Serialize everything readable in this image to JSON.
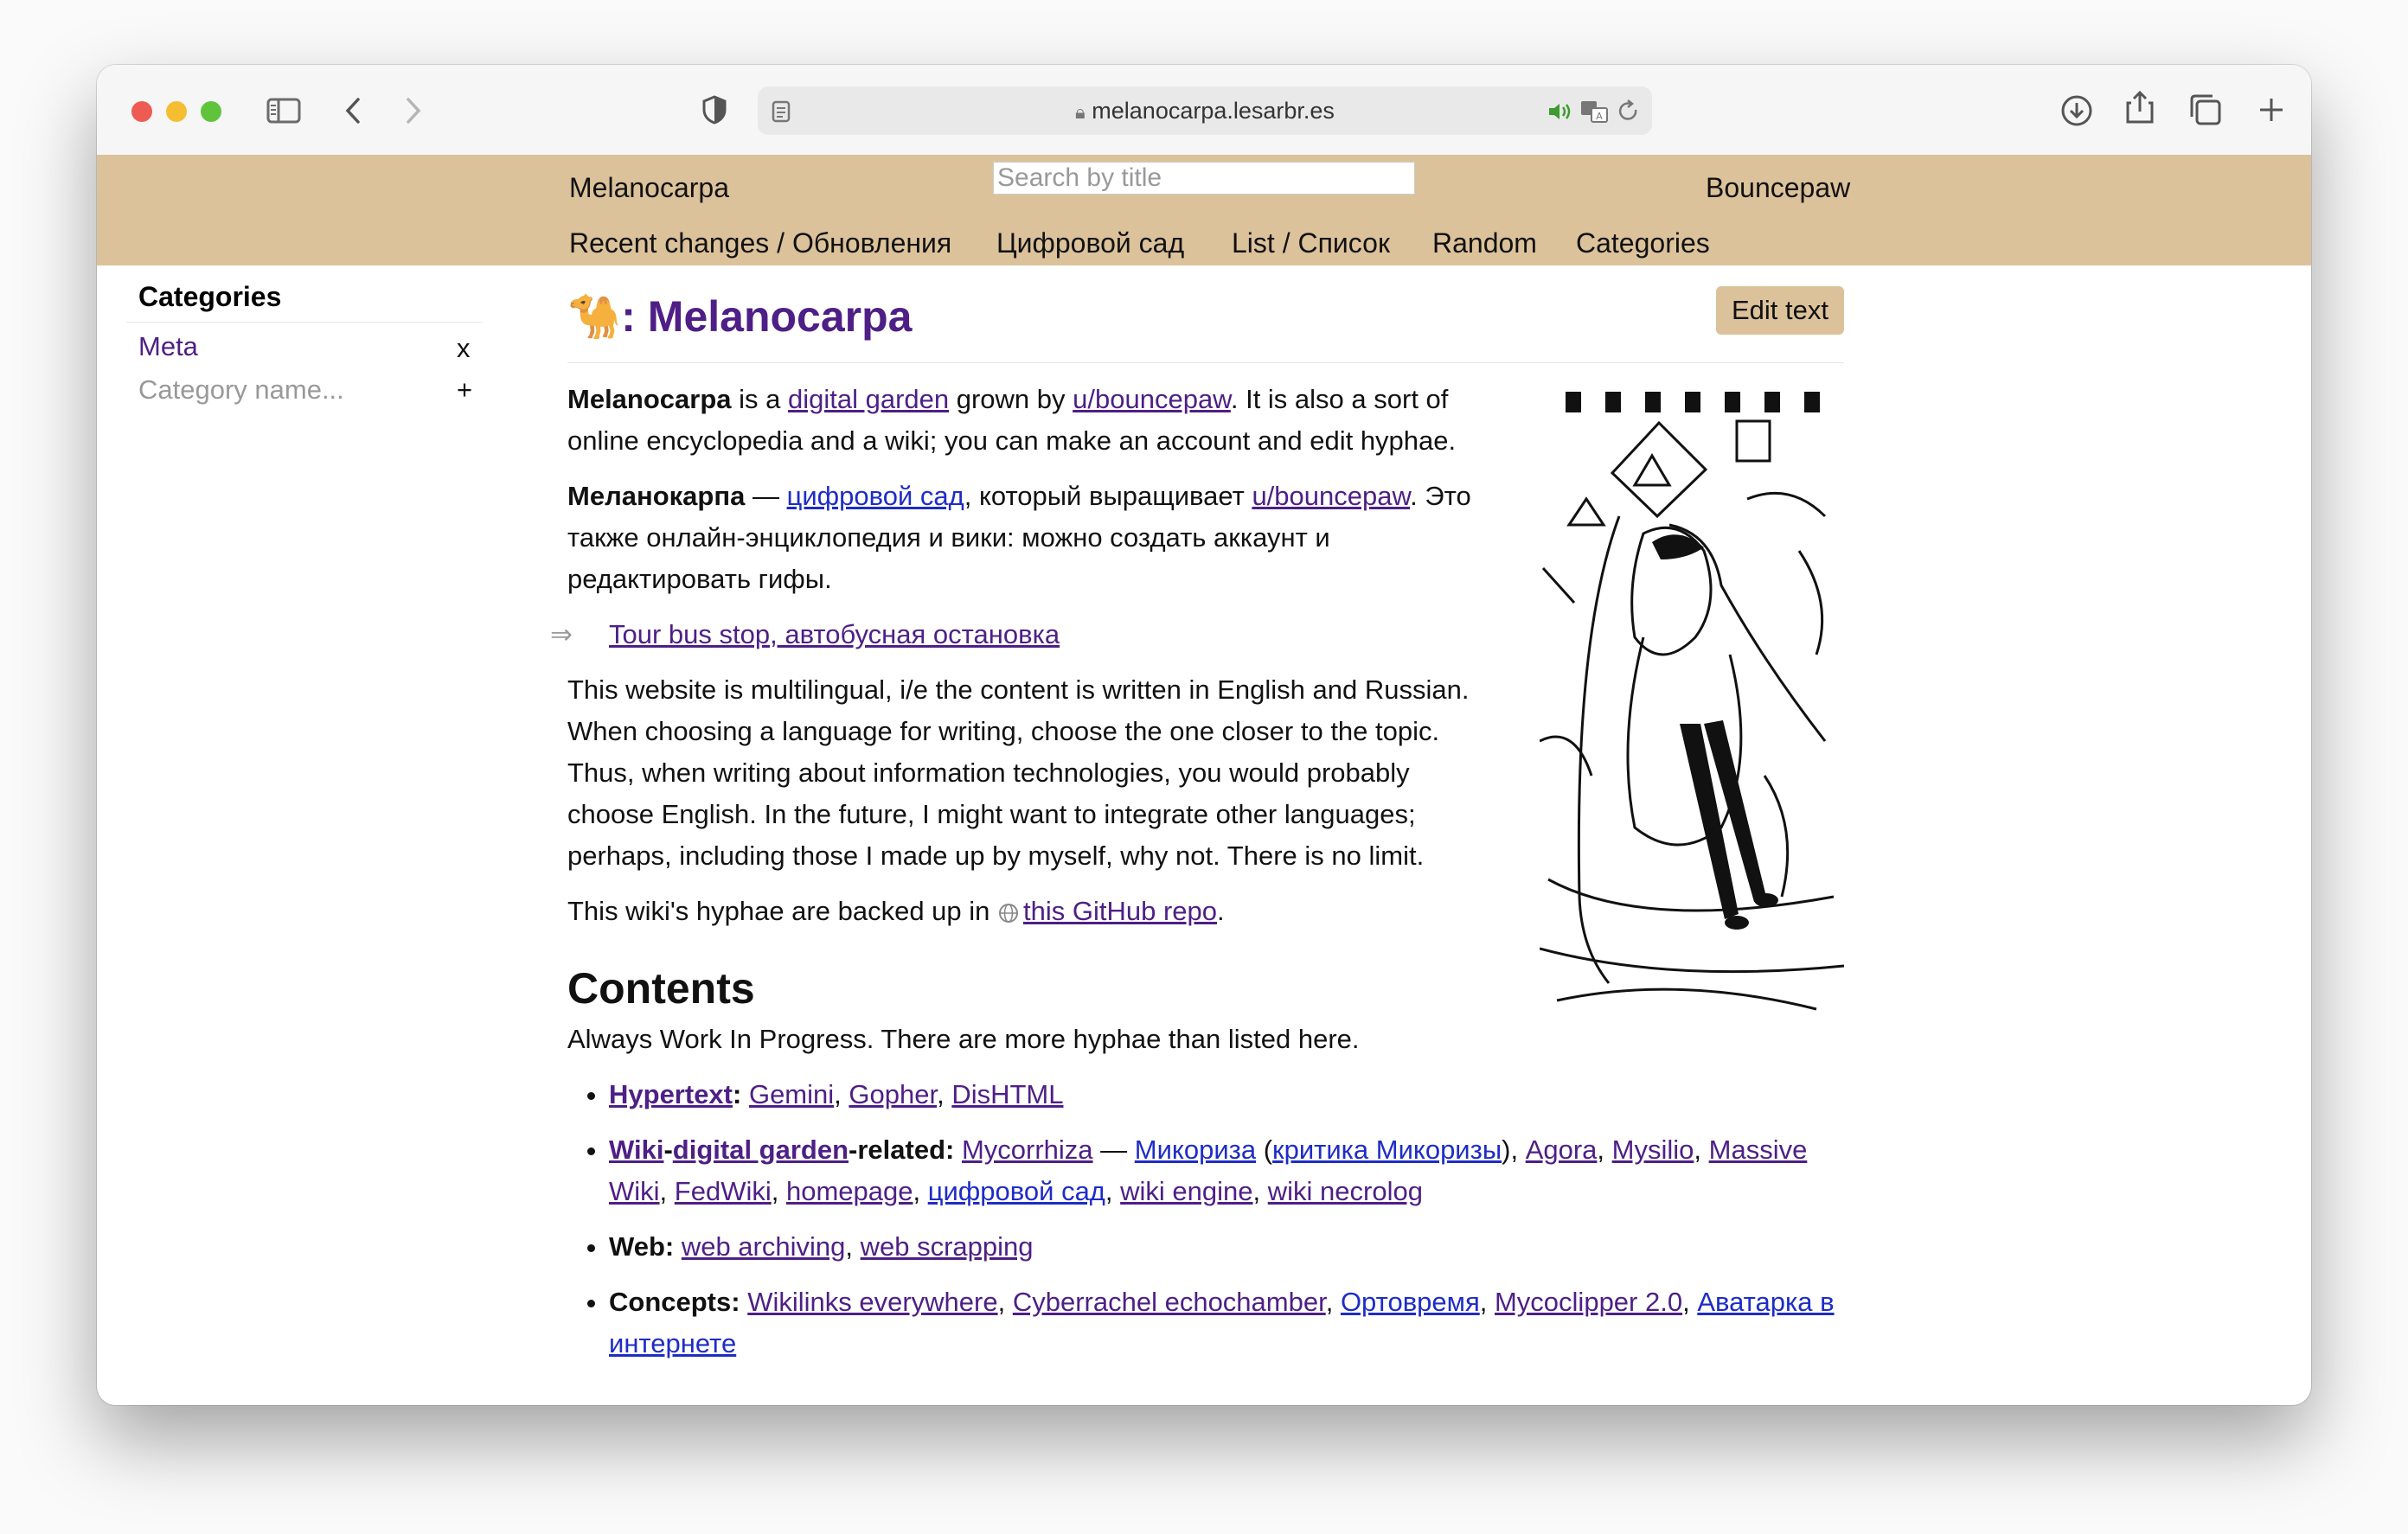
{
  "browser": {
    "url": "melanocarpa.lesarbr.es",
    "colors": {
      "close": "#ee5b52",
      "minimize": "#f5be32",
      "zoom": "#5fc43c"
    }
  },
  "header": {
    "site_name": "Melanocarpa",
    "search_placeholder": "Search by title",
    "user": "Bouncepaw",
    "nav": [
      "Recent changes / Обновления",
      "Цифровой сад",
      "List / Список",
      "Random",
      "Categories"
    ]
  },
  "sidebar": {
    "title": "Categories",
    "category": "Meta",
    "remove_label": "x",
    "placeholder": "Category name...",
    "add_label": "+"
  },
  "page": {
    "title_emoji": "🐪",
    "title": ": Melanocarpa",
    "edit_button": "Edit text",
    "p1": {
      "b": "Melanocarpa",
      "t1": " is a ",
      "l1": "digital garden",
      "t2": " grown by ",
      "l2": "u/bouncepaw",
      "t3": ". It is also a sort of online encyclopedia and a wiki; you can make an account and edit hyphae."
    },
    "p2": {
      "b": "Меланокарпа",
      "t1": " — ",
      "l1": "цифровой сад",
      "t2": ", который выращивает ",
      "l2": "u/bouncepaw",
      "t3": ". Это также онлайн-энциклопедия и вики: можно создать аккаунт и редактировать гифы."
    },
    "transclusion_arrow": "⇒",
    "transclusion_link": "Tour bus stop, автобусная остановка",
    "p3": "This website is multilingual, i/e the content is written in English and Russian. When choosing a language for writing, choose the one closer to the topic. Thus, when writing about information technologies, you would probably choose English. In the future, I might want to integrate other languages; perhaps, including those I made up by myself, why not. There is no limit.",
    "p4": {
      "t1": "This wiki's hyphae are backed up in ",
      "link": "this GitHub repo",
      "t2": "."
    },
    "contents_title": "Contents",
    "contents_intro": "Always Work In Progress. There are more hyphae than listed here.",
    "toc": {
      "hypertext": {
        "label": "Hypertext",
        "links": [
          "Gemini",
          "Gopher",
          "DisHTML"
        ]
      },
      "wiki": {
        "l1": "Wiki",
        "l2": "digital garden",
        "suffix": "-related:",
        "a": "Mycorrhiza",
        "dash": " — ",
        "b": "Микориза",
        "c": "критика Микоризы",
        "rest": [
          "Agora",
          "Mysilio",
          "Massive Wiki",
          "FedWiki",
          "homepage",
          "цифровой сад",
          "wiki engine",
          "wiki necrolog"
        ]
      },
      "web": {
        "label": "Web:",
        "links": [
          "web archiving",
          "web scrapping"
        ]
      },
      "concepts": {
        "label": "Concepts:",
        "links": [
          "Wikilinks everywhere",
          "Cyberrachel echochamber",
          "Ортовремя",
          "Mycoclipper 2.0",
          "Аватарка в интернете"
        ]
      }
    }
  }
}
